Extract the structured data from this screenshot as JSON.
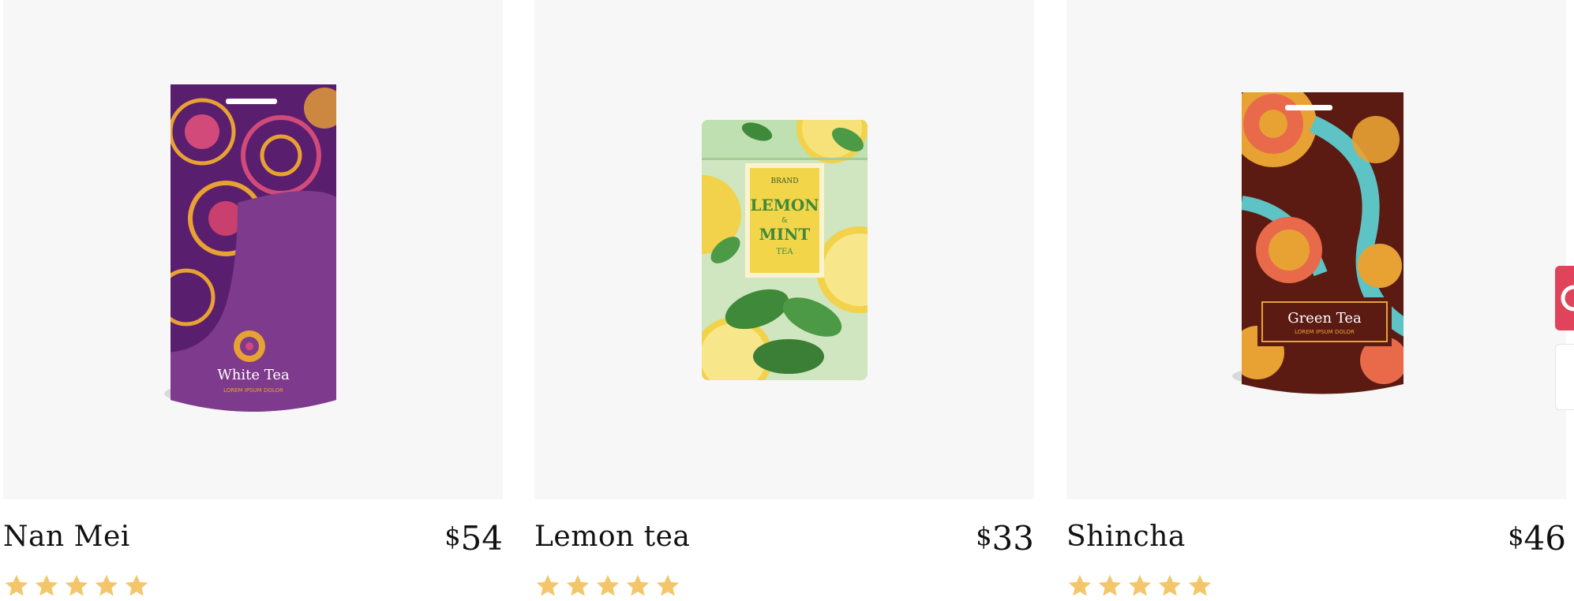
{
  "products": [
    {
      "name": "Nan Mei",
      "currency": "$",
      "price": "54",
      "rating": 5,
      "package": {
        "type": "pouch",
        "label": "White Tea",
        "sublabel": "LOREM IPSUM DOLOR",
        "base_color": "#6a2a7e",
        "accent_color": "#e8a234"
      }
    },
    {
      "name": "Lemon tea",
      "currency": "$",
      "price": "33",
      "rating": 5,
      "package": {
        "type": "tin",
        "brand": "BRAND",
        "label_line1": "LEMON",
        "label_amp": "&",
        "label_line2": "MINT",
        "label_line3": "TEA",
        "base_color": "#cfe6c0",
        "accent_color": "#f1d24a"
      }
    },
    {
      "name": "Shincha",
      "currency": "$",
      "price": "46",
      "rating": 5,
      "package": {
        "type": "pouch",
        "label": "Green Tea",
        "sublabel": "LOREM IPSUM DOLOR",
        "base_color": "#5b1b12",
        "accent_color": "#5ec3c4"
      }
    }
  ],
  "star_color": "#f3c66a"
}
